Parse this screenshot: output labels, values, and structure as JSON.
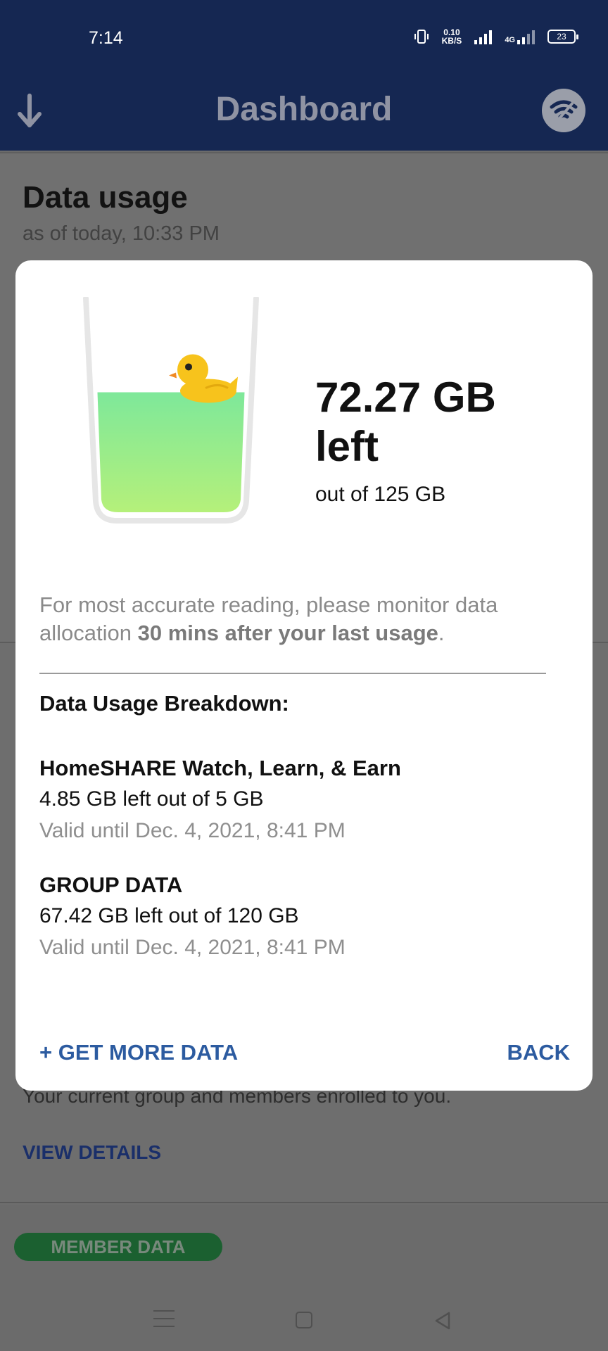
{
  "status_bar": {
    "time": "7:14",
    "net_speed_value": "0.10",
    "net_speed_unit": "KB/S",
    "network_type": "4G",
    "battery": "23"
  },
  "header": {
    "title": "Dashboard",
    "left_icon": "download-arrow-icon",
    "right_icon": "wifi-icon"
  },
  "data_usage_card": {
    "title": "Data usage",
    "subtitle": "as of today, 10:33 PM"
  },
  "group_card": {
    "description": "Your current group and members enrolled to you.",
    "view_details": "VIEW DETAILS",
    "member_data_pill": "MEMBER DATA"
  },
  "modal": {
    "remaining_line1": "72.27 GB",
    "remaining_line2": "left",
    "out_of": "out of 125 GB",
    "remaining_fraction": 0.578,
    "note_prefix": "For most accurate reading, please monitor data allocation ",
    "note_bold": "30 mins after your last usage",
    "note_suffix": ".",
    "breakdown_title": "Data Usage Breakdown:",
    "entries": [
      {
        "name": "HomeSHARE Watch, Learn, & Earn",
        "amount": "4.85 GB left out of 5 GB",
        "valid": "Valid until Dec. 4, 2021, 8:41 PM"
      },
      {
        "name": "GROUP DATA",
        "amount": "67.42 GB left out of 120 GB",
        "valid": "Valid until Dec. 4, 2021, 8:41 PM"
      }
    ],
    "get_more_label": "+ GET MORE DATA",
    "back_label": "BACK"
  },
  "nav": {
    "menu_icon": "menu-icon",
    "home_icon": "home-square-icon",
    "back_icon": "back-triangle-icon"
  },
  "colors": {
    "header_bg": "#152752",
    "accent_blue": "#2c5ba0",
    "liquid_top": "#7ee89a",
    "liquid_bottom": "#b5f07a",
    "member_pill": "#1b6030"
  }
}
